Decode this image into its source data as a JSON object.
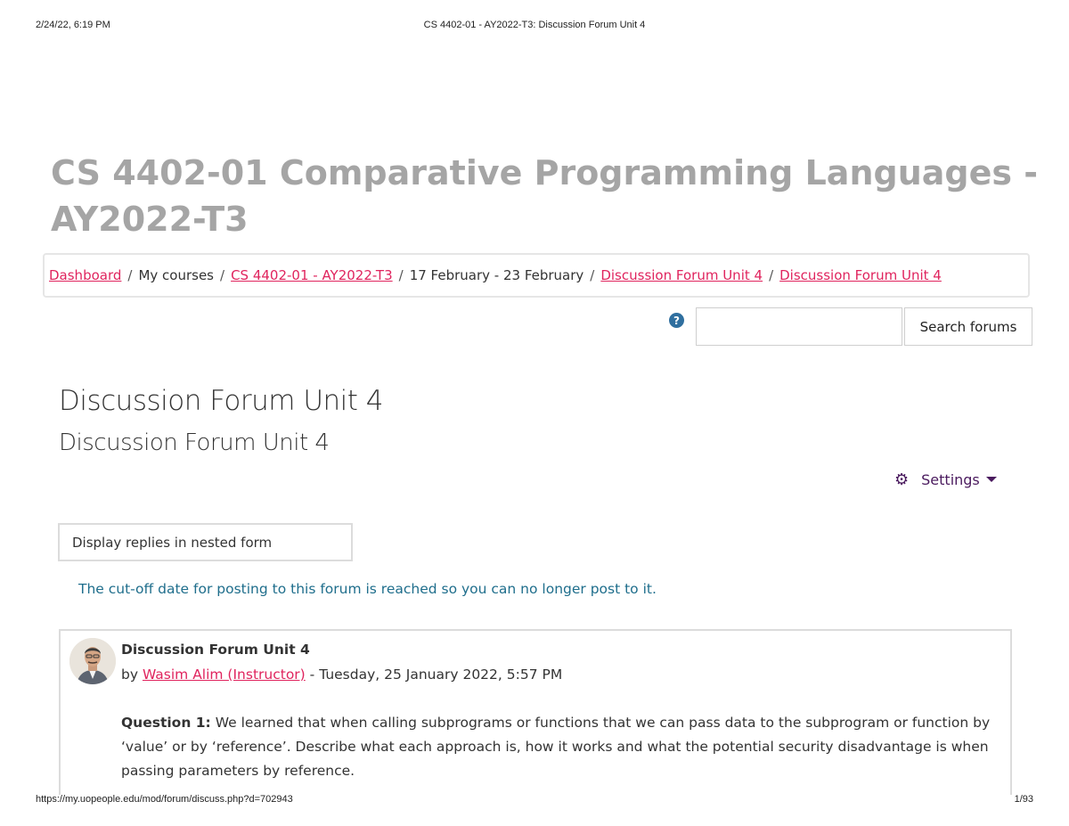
{
  "print_header": {
    "date": "2/24/22, 6:19 PM",
    "title": "CS 4402-01 - AY2022-T3: Discussion Forum Unit 4"
  },
  "print_footer": {
    "url": "https://my.uopeople.edu/mod/forum/discuss.php?d=702943",
    "page": "1/93"
  },
  "course": {
    "title": "CS 4402-01 Comparative Programming Languages - AY2022-T3"
  },
  "breadcrumb": {
    "dashboard": "Dashboard",
    "my_courses": "My courses",
    "course": "CS 4402-01 - AY2022-T3",
    "week": "17 February - 23 February",
    "forum": "Discussion Forum Unit 4",
    "discussion": "Discussion Forum Unit 4",
    "separator": "/"
  },
  "search": {
    "help_icon": "question-circle-icon",
    "input_value": "",
    "button_label": "Search forums"
  },
  "forum": {
    "heading": "Discussion Forum Unit 4",
    "subheading": "Discussion Forum Unit 4",
    "settings_label": "Settings",
    "display_mode": "Display replies in nested form",
    "cutoff_notice": "The cut-off date for posting to this forum is reached so you can no longer post to it."
  },
  "post": {
    "subject": "Discussion Forum Unit 4",
    "by_prefix": "by",
    "author": "Wasim Alim (Instructor)",
    "date_separator": "-",
    "date": "Tuesday, 25 January 2022, 5:57 PM",
    "question_label": "Question 1:",
    "question_text": "We learned that when calling subprograms or functions that we can pass data to the subprogram or function by ‘value’ or by ‘reference’.   Describe what each approach is, how it works and what the potential security disadvantage is when passing parameters by reference."
  },
  "colors": {
    "link": "#e0245e",
    "notice": "#1f6e8c",
    "settings": "#4a1a5e",
    "course_title": "#a5a5a5"
  }
}
